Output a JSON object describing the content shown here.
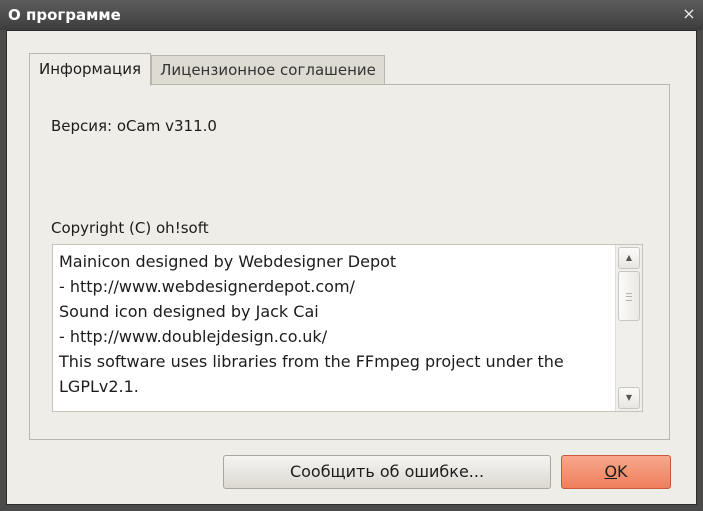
{
  "window": {
    "title": "О программе",
    "close_glyph": "×"
  },
  "tabs": [
    {
      "label": "Информация",
      "active": true
    },
    {
      "label": "Лицензионное соглашение",
      "active": false
    }
  ],
  "info": {
    "version": "Версия: oCam v311.0",
    "copyright": "Copyright (C) oh!soft",
    "credits_lines": [
      "Mainicon designed by Webdesigner Depot",
      "- http://www.webdesignerdepot.com/",
      "Sound icon designed by Jack Cai",
      "- http://www.doublejdesign.co.uk/",
      "This software uses libraries from the FFmpeg project under the",
      "LGPLv2.1."
    ]
  },
  "scrollbar": {
    "up_glyph": "▲",
    "down_glyph": "▼"
  },
  "buttons": {
    "report_label": "Сообщить об ошибке...",
    "ok_label_first": "O",
    "ok_label_rest": "K"
  }
}
